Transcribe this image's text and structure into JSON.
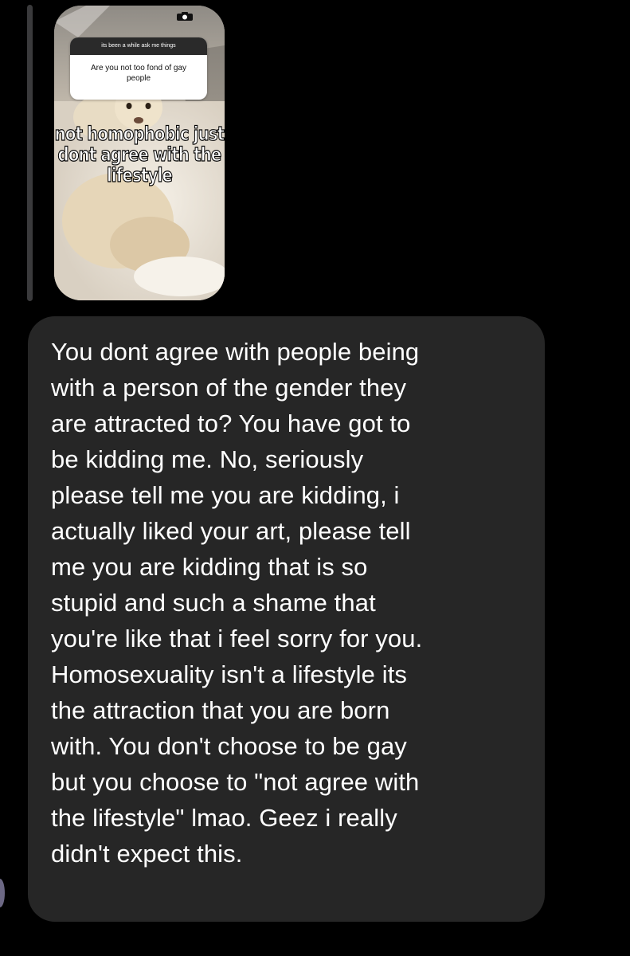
{
  "story_reply": {
    "ask_prompt": "its been a while ask me things",
    "question": "Are you not too fond of gay people",
    "meme_caption": "not homophobic just\ndont agree with the\nlifestyle",
    "camera_icon": "camera-icon"
  },
  "message": {
    "text": "You dont agree with people being\nwith a person of the gender they\nare attracted to? You have got to\nbe kidding me. No, seriously\nplease tell me you are kidding, i\nactually liked your art, please tell\nme you are kidding that is so\nstupid and such a shame that\nyou're like that i feel sorry for you.\nHomosexuality isn't a lifestyle its\nthe attraction that you are born\nwith. You don't choose to be gay\nbut you choose to \"not agree with\nthe lifestyle\" lmao. Geez i really\ndidn't expect this."
  },
  "colors": {
    "background": "#000000",
    "bubble": "#262626",
    "reply_bar": "#3a3a3c",
    "text": "#ffffff"
  }
}
